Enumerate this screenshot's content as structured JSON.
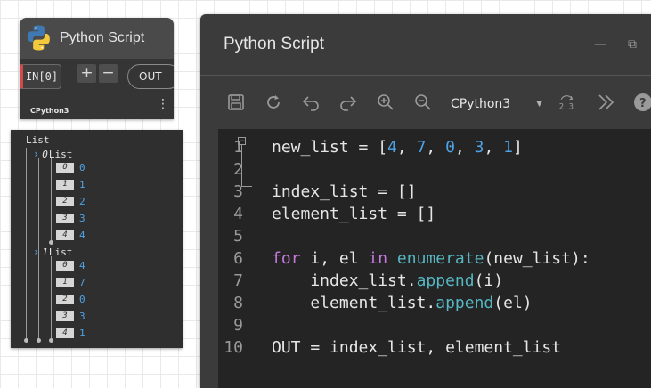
{
  "node": {
    "title": "Python Script",
    "input_port": "IN[0]",
    "add_label": "+",
    "remove_label": "−",
    "output_port": "OUT",
    "engine": "CPython3",
    "menu_glyph": "⋮"
  },
  "preview": {
    "root_label": "List",
    "sublists": [
      {
        "index": "0",
        "label": "List",
        "items": [
          {
            "index": "0",
            "value": "0"
          },
          {
            "index": "1",
            "value": "1"
          },
          {
            "index": "2",
            "value": "2"
          },
          {
            "index": "3",
            "value": "3"
          },
          {
            "index": "4",
            "value": "4"
          }
        ]
      },
      {
        "index": "1",
        "label": "List",
        "items": [
          {
            "index": "0",
            "value": "4"
          },
          {
            "index": "1",
            "value": "7"
          },
          {
            "index": "2",
            "value": "0"
          },
          {
            "index": "3",
            "value": "3"
          },
          {
            "index": "4",
            "value": "1"
          }
        ]
      }
    ]
  },
  "editor": {
    "title": "Python Script",
    "engine_select": "CPython3",
    "toolbar_icons": [
      "save-icon",
      "run-icon",
      "undo-icon",
      "redo-icon",
      "zoom-in-icon",
      "zoom-out-icon",
      "convert-icon",
      "more-icon",
      "help-icon"
    ],
    "code_lines": [
      {
        "num": "1",
        "tokens": [
          {
            "t": "new_list = [",
            "c": ""
          },
          {
            "t": "4",
            "c": "num"
          },
          {
            "t": ", ",
            "c": ""
          },
          {
            "t": "7",
            "c": "num"
          },
          {
            "t": ", ",
            "c": ""
          },
          {
            "t": "0",
            "c": "num"
          },
          {
            "t": ", ",
            "c": ""
          },
          {
            "t": "3",
            "c": "num"
          },
          {
            "t": ", ",
            "c": ""
          },
          {
            "t": "1",
            "c": "num"
          },
          {
            "t": "]",
            "c": ""
          }
        ]
      },
      {
        "num": "2",
        "tokens": []
      },
      {
        "num": "3",
        "tokens": [
          {
            "t": "index_list = []",
            "c": ""
          }
        ]
      },
      {
        "num": "4",
        "tokens": [
          {
            "t": "element_list = []",
            "c": ""
          }
        ]
      },
      {
        "num": "5",
        "tokens": []
      },
      {
        "num": "6",
        "tokens": [
          {
            "t": "for",
            "c": "kw"
          },
          {
            "t": " i, el ",
            "c": ""
          },
          {
            "t": "in",
            "c": "kw"
          },
          {
            "t": " ",
            "c": ""
          },
          {
            "t": "enumerate",
            "c": "fn"
          },
          {
            "t": "(new_list):",
            "c": ""
          }
        ]
      },
      {
        "num": "7",
        "tokens": [
          {
            "t": "    index_list.",
            "c": ""
          },
          {
            "t": "append",
            "c": "fn"
          },
          {
            "t": "(i)",
            "c": ""
          }
        ]
      },
      {
        "num": "8",
        "tokens": [
          {
            "t": "    element_list.",
            "c": ""
          },
          {
            "t": "append",
            "c": "fn"
          },
          {
            "t": "(el)",
            "c": ""
          }
        ]
      },
      {
        "num": "9",
        "tokens": []
      },
      {
        "num": "10",
        "tokens": [
          {
            "t": "OUT = index_list, element_list",
            "c": ""
          }
        ]
      }
    ]
  },
  "colors": {
    "accent_blue": "#4ea3e6",
    "port_red": "#d14a49",
    "keyword": "#c678dd",
    "function": "#56b6c2"
  }
}
